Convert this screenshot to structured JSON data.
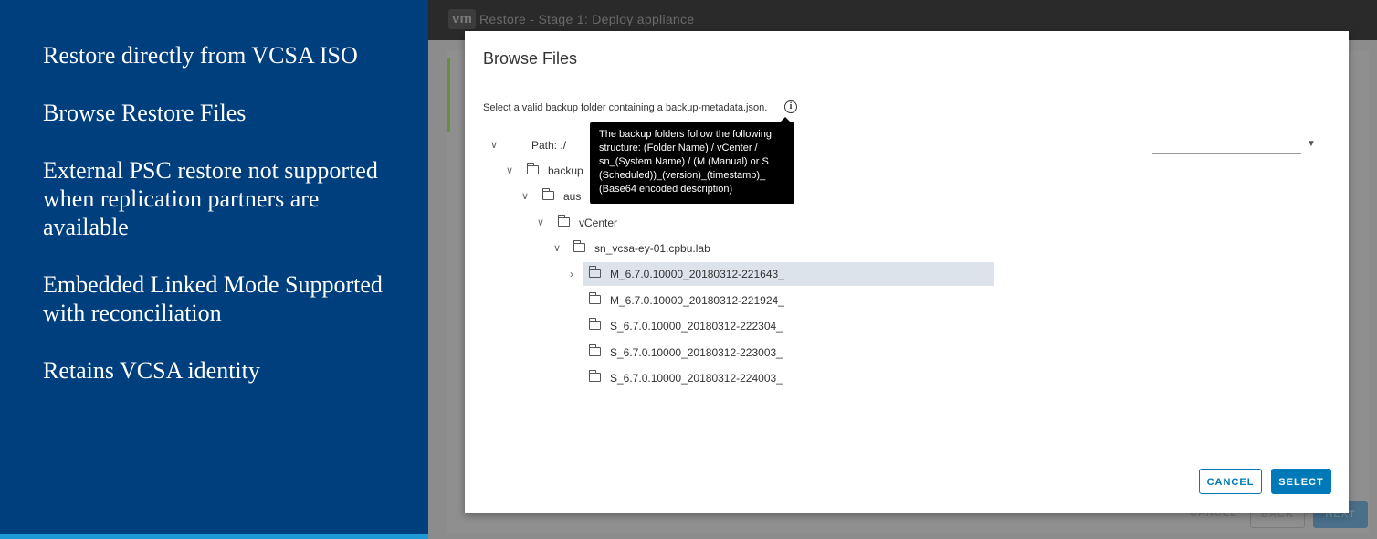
{
  "slide": {
    "bullets": [
      "Restore directly from VCSA ISO",
      "Browse Restore Files",
      "External PSC restore not supported when replication partners are available",
      "Embedded Linked Mode Supported with reconciliation",
      "Retains VCSA identity"
    ]
  },
  "app": {
    "logo": "vm",
    "title": "Restore - Stage 1: Deploy appliance",
    "footer": {
      "cancel": "CANCEL",
      "back": "BACK",
      "next": "NEXT"
    }
  },
  "dialog": {
    "title": "Browse Files",
    "instruction": "Select a valid backup folder containing a backup-metadata.json.",
    "info_icon": "info-icon",
    "tooltip": "The backup folders follow the following structure: (Folder Name) / vCenter / sn_(System Name) / (M (Manual) or S (Scheduled))_(version)_(timestamp)_ (Base64 encoded description)",
    "tree": {
      "path": "Path: ./",
      "backup": "backup",
      "aus": "aus",
      "vcenter": "vCenter",
      "system": "sn_vcsa-ey-01.cpbu.lab",
      "items": [
        "M_6.7.0.10000_20180312-221643_",
        "M_6.7.0.10000_20180312-221924_",
        "S_6.7.0.10000_20180312-222304_",
        "S_6.7.0.10000_20180312-223003_",
        "S_6.7.0.10000_20180312-224003_"
      ]
    },
    "buttons": {
      "cancel": "CANCEL",
      "select": "SELECT"
    }
  }
}
